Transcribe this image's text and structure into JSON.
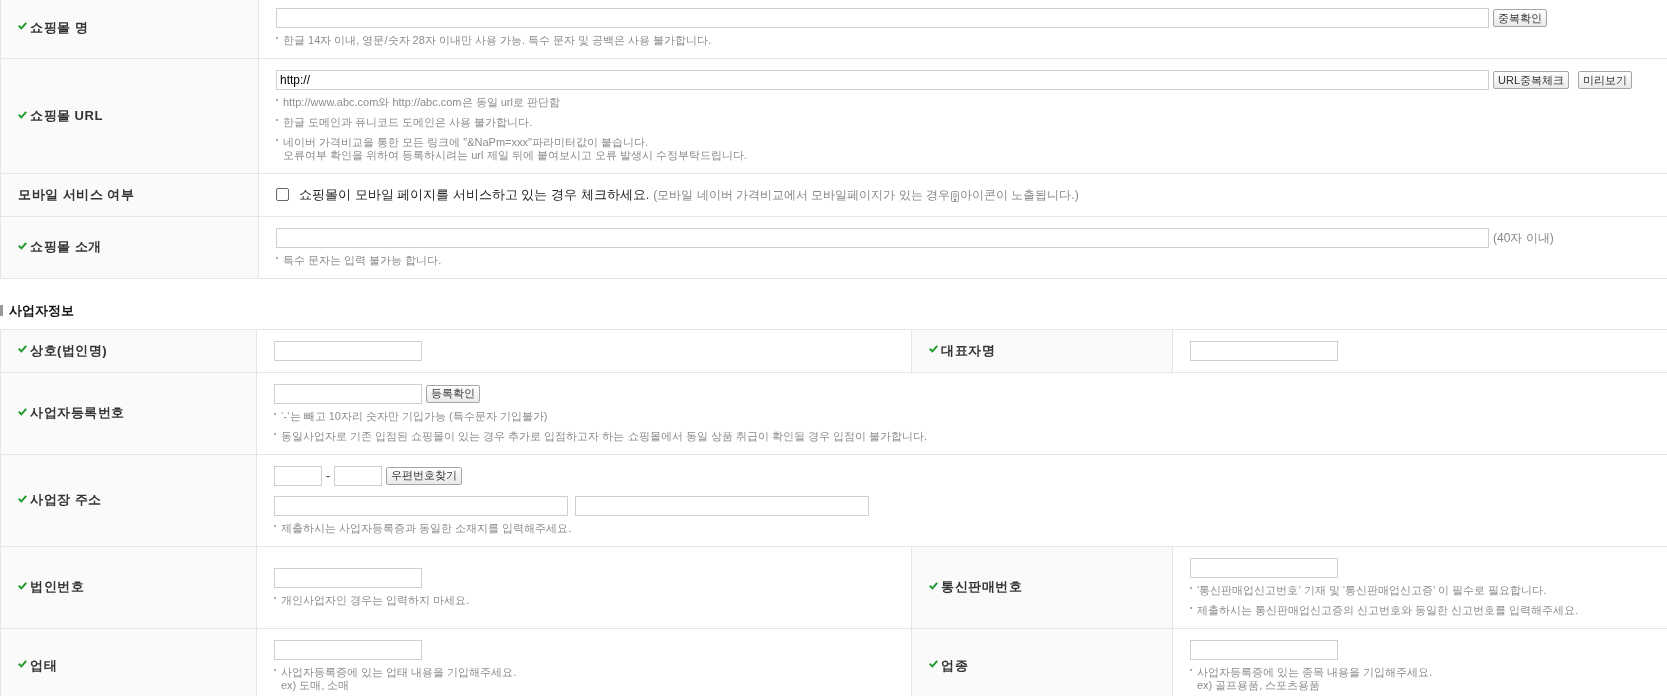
{
  "shop_info": {
    "rows": [
      {
        "label": "쇼핑몰 명",
        "required": true,
        "control_rows": [
          [
            {
              "kind": "long_input"
            },
            {
              "kind": "button",
              "label": "중복확인"
            }
          ]
        ],
        "hints": [
          "한글 14자 이내, 영문/숫자 28자 이내만 사용 가능. 특수 문자 및 공백은 사용 불가합니다."
        ]
      },
      {
        "label": "쇼핑몰 URL",
        "required": true,
        "control_rows": [
          [
            {
              "kind": "long_input",
              "value": "http://"
            },
            {
              "kind": "button",
              "label": "URL중복체크"
            },
            {
              "kind": "button",
              "label": "미리보기"
            }
          ]
        ],
        "hints": [
          "http://www.abc.com와 http://abc.com은 동일 url로 판단함",
          "한글 도메인과 퓨니코드 도메인은 사용 불가합니다.",
          "네이버 가격비교을 통한 모든 링크에 \"&NaPm=xxx\"파라미터값이 붙습니다.\n오류여부 확인을 위하여 등록하시려는 url 제일 뒤에 붙여보시고 오류 발생시 수정부탁드립니다."
        ]
      },
      {
        "label": "모바일 서비스 여부",
        "required": false,
        "control_rows": [
          [
            {
              "kind": "checkbox",
              "checked": false,
              "label": "쇼핑몰이 모바일 페이지를 서비스하고 있는 경우 체크하세요.",
              "note": "(모바일 네이버 가격비교에서 모바일페이지가 있는 경우",
              "note_after_icon": "아이콘이 노출됩니다.)"
            }
          ]
        ]
      },
      {
        "label": "쇼핑몰 소개",
        "required": true,
        "control_rows": [
          [
            {
              "kind": "long_input"
            },
            {
              "kind": "note",
              "text": "(40자 이내)"
            }
          ]
        ],
        "hints": [
          "특수 문자는 입력 불가능 합니다."
        ]
      }
    ]
  },
  "business_info": {
    "title": "사업자정보",
    "rows": [
      {
        "fields": [
          {
            "label": "상호(법인명)",
            "required": true,
            "control_rows": [
              [
                {
                  "kind": "short_input"
                }
              ]
            ]
          },
          {
            "label": "대표자명",
            "required": true,
            "control_rows": [
              [
                {
                  "kind": "short_input"
                }
              ]
            ]
          }
        ]
      },
      {
        "fields": [
          {
            "label": "사업자등록번호",
            "required": true,
            "control_rows": [
              [
                {
                  "kind": "short_input"
                },
                {
                  "kind": "button",
                  "label": "등록확인"
                }
              ]
            ],
            "hints": [
              "‘-’는 빼고 10자리 숫자만 기입가능 (특수문자 기입불가)",
              "동일사업자로 기존 입점된 쇼핑몰이 있는 경우 추가로 입점하고자 하는 쇼핑몰에서 동일 상품 취급이 확인될 경우 입점이 불가합니다."
            ]
          }
        ]
      },
      {
        "fields": [
          {
            "label": "사업장 주소",
            "required": true,
            "control_rows": [
              [
                {
                  "kind": "zip_input"
                },
                {
                  "kind": "text",
                  "text": "-"
                },
                {
                  "kind": "zip_input"
                },
                {
                  "kind": "button",
                  "label": "우편번호찾기"
                }
              ],
              [
                {
                  "kind": "address_input"
                },
                {
                  "kind": "address_input"
                }
              ]
            ],
            "hints": [
              "제출하시는 사업자등록증과 동일한 소재지를 입력해주세요."
            ]
          }
        ]
      },
      {
        "fields": [
          {
            "label": "법인번호",
            "required": true,
            "control_rows": [
              [
                {
                  "kind": "short_input"
                }
              ]
            ],
            "hints": [
              "개인사업자인 경우는 입력하지 마세요."
            ]
          },
          {
            "label": "통신판매번호",
            "required": true,
            "control_rows": [
              [
                {
                  "kind": "short_input"
                }
              ]
            ],
            "hints": [
              "‘통신판매업신고번호’ 기재 및 ‘통신판매업신고증’ 이 필수로 필요합니다.",
              "제출하시는 통신판매업신고증의 신고번호와 동일한 신고번호를 입력해주세요."
            ]
          }
        ]
      },
      {
        "fields": [
          {
            "label": "업태",
            "required": true,
            "control_rows": [
              [
                {
                  "kind": "short_input"
                }
              ]
            ],
            "hints": [
              "사업자등록증에 있는 업태 내용을 기입해주세요.\nex) 도매, 소매"
            ]
          },
          {
            "label": "업종",
            "required": true,
            "control_rows": [
              [
                {
                  "kind": "short_input"
                }
              ]
            ],
            "hints": [
              "사업자등록증에 있는 종목 내용을 기입해주세요.\nex) 골프용품, 스포츠용품"
            ]
          }
        ]
      }
    ]
  }
}
